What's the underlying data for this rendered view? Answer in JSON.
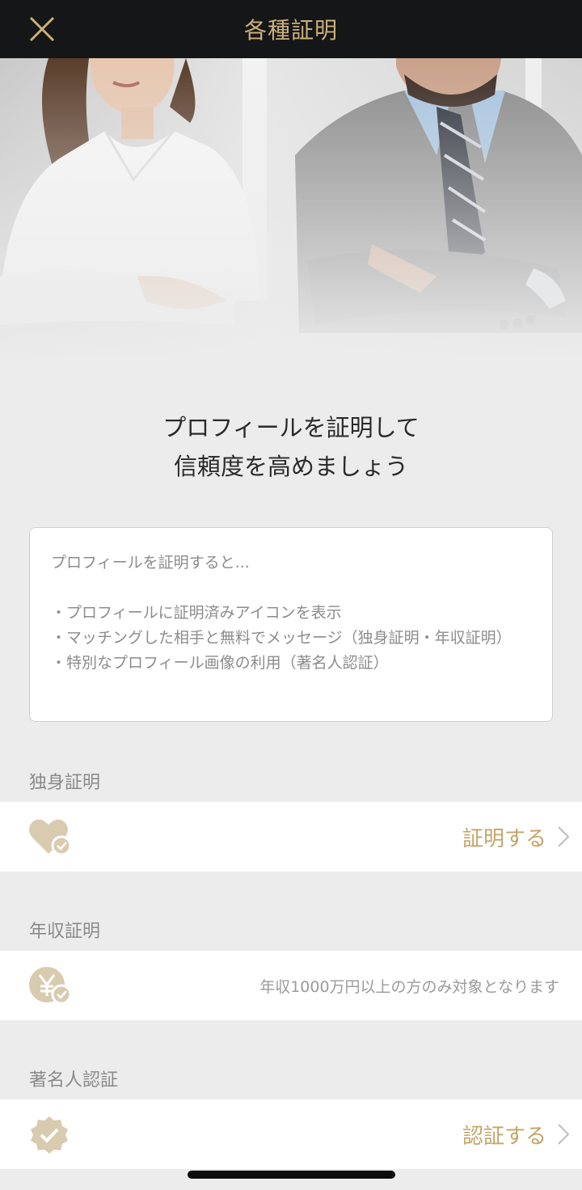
{
  "header": {
    "title": "各種証明",
    "close_icon": "close-icon"
  },
  "hero": {
    "image": "business-man-and-woman-photo"
  },
  "heading": {
    "line1": "プロフィールを証明して",
    "line2": "信頼度を高めましょう"
  },
  "info": {
    "intro": "プロフィールを証明すると...",
    "bullets": [
      "・プロフィールに証明済みアイコンを表示",
      "・マッチングした相手と無料でメッセージ（独身証明・年収証明）",
      "・特別なプロフィール画像の利用（著名人認証）"
    ]
  },
  "sections": {
    "single": {
      "label": "独身証明",
      "icon": "heart-check-icon",
      "action": "証明する"
    },
    "income": {
      "label": "年収証明",
      "icon": "yen-check-icon",
      "note": "年収1000万円以上の方のみ対象となります"
    },
    "celebrity": {
      "label": "著名人認証",
      "icon": "verified-badge-icon",
      "action": "認証する"
    }
  },
  "colors": {
    "accent": "#c4a46a",
    "header_bg": "#151618",
    "icon_fill": "#d9cbb0"
  }
}
